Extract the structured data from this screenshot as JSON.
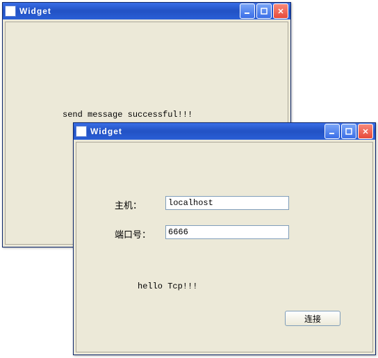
{
  "window1": {
    "title": "Widget",
    "message": "send message successful!!!"
  },
  "window2": {
    "title": "Widget",
    "form": {
      "host_label": "主机：",
      "host_value": "localhost",
      "port_label": "端口号：",
      "port_value": "6666"
    },
    "message": "hello Tcp!!!",
    "connect_button": "连接"
  }
}
